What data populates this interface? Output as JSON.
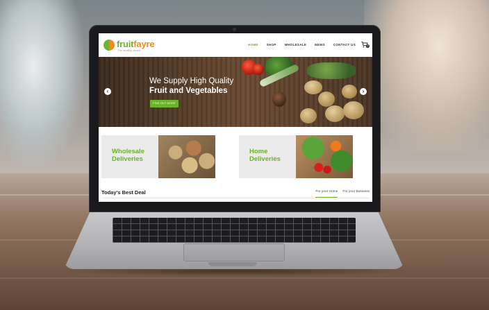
{
  "site": {
    "logo": {
      "part1": "fruit",
      "part2": "fayre",
      "tagline": "The healthy choice"
    },
    "nav": [
      {
        "label": "HOME",
        "active": true
      },
      {
        "label": "SHOP",
        "active": false
      },
      {
        "label": "WHOLESALE",
        "active": false
      },
      {
        "label": "NEWS",
        "active": false
      },
      {
        "label": "CONTACT US",
        "active": false
      }
    ],
    "cart_count": "0",
    "hero": {
      "line1": "We Supply High Quality",
      "line2": "Fruit and Vegetables",
      "button": "FIND OUT MORE",
      "prev": "‹",
      "next": "›"
    },
    "promos": [
      {
        "line1": "Wholesale",
        "line2": "Deliveries",
        "image": "potatoes"
      },
      {
        "line1": "Home",
        "line2": "Deliveries",
        "image": "vegetable-basket"
      }
    ],
    "deals": {
      "title": "Today's Best Deal",
      "tabs": [
        {
          "label": "For your Home",
          "active": true
        },
        {
          "label": "For your Business",
          "active": false
        }
      ]
    }
  },
  "colors": {
    "brand_green": "#6bb42b",
    "brand_orange": "#f08a1c"
  }
}
